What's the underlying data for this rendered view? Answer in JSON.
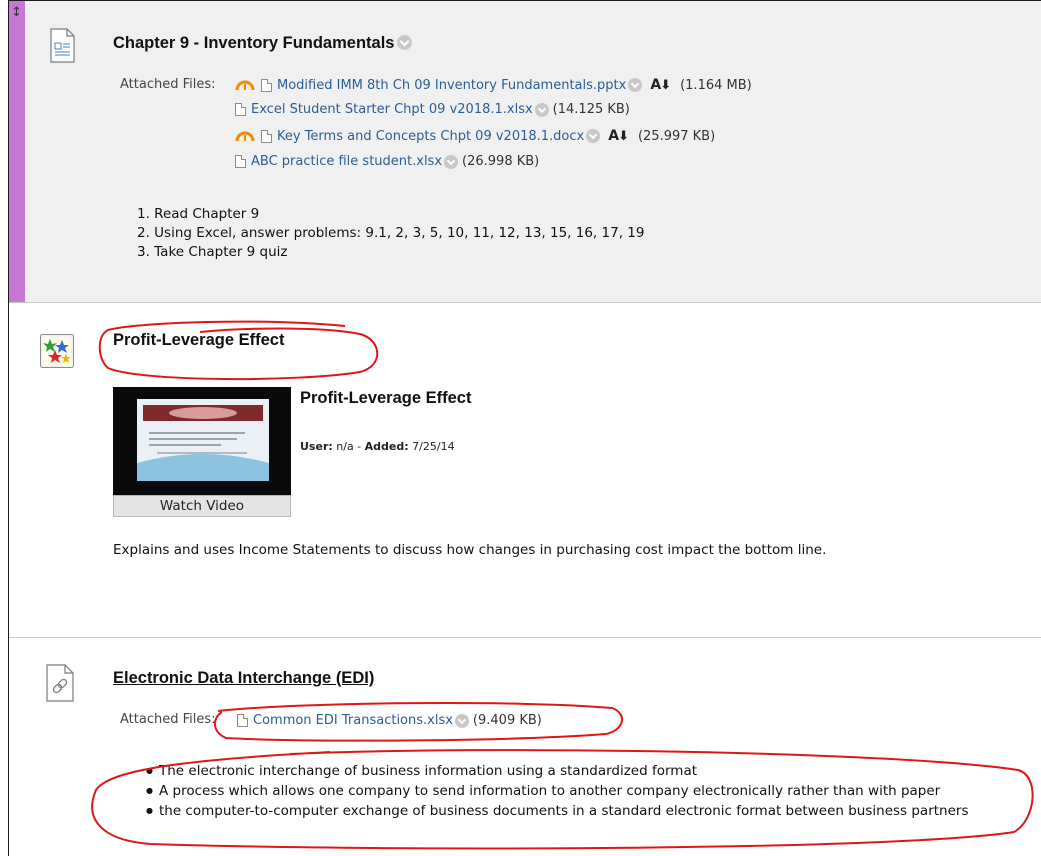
{
  "chapter_item": {
    "title": "Chapter 9 - Inventory Fundamentals",
    "attached_label": "Attached Files:",
    "files": [
      {
        "name": "Modified IMM 8th Ch 09 Inventory Fundamentals.pptx",
        "size": "(1.164 MB)",
        "icon": "gauge-icon",
        "extra": "A-Z-down-icon"
      },
      {
        "name": "Excel Student Starter Chpt 09 v2018.1.xlsx",
        "size": "(14.125 KB)"
      },
      {
        "name": "Key Terms and Concepts Chpt 09 v2018.1.docx",
        "size": "(25.997 KB)",
        "icon": "gauge-icon",
        "extra": "A-Z-down-icon"
      },
      {
        "name": "ABC practice file student.xlsx",
        "size": "(26.998 KB)"
      }
    ],
    "steps": [
      "1. Read Chapter 9",
      "2. Using Excel, answer problems: 9.1, 2, 3, 5, 10, 11, 12, 13, 15, 16, 17, 19",
      "3. Take Chapter 9 quiz"
    ]
  },
  "video_item": {
    "title": "Profit-Leverage Effect",
    "video_title": "Profit-Leverage Effect",
    "user_label": "User:",
    "user_value": "n/a",
    "added_label": "Added:",
    "added_value": "7/25/14",
    "watch_label": "Watch Video",
    "description": "Explains and uses Income Statements to discuss how changes in purchasing cost impact the bottom line."
  },
  "edi_item": {
    "title": "Electronic Data Interchange (EDI)",
    "attached_label": "Attached Files:",
    "file_name": "Common EDI Transactions.xlsx",
    "file_size": "(9.409 KB)",
    "bullets": [
      "The electronic interchange of business information using a standardized format",
      "A process which allows one company to send information to another company electronically rather than with paper",
      "the computer-to-computer exchange of business documents in a standard electronic format between business partners"
    ]
  },
  "colors": {
    "accent_bar": "#c778d4",
    "link": "#2a5e95",
    "annotation": "#e01616",
    "gauge": "#f08a00"
  }
}
